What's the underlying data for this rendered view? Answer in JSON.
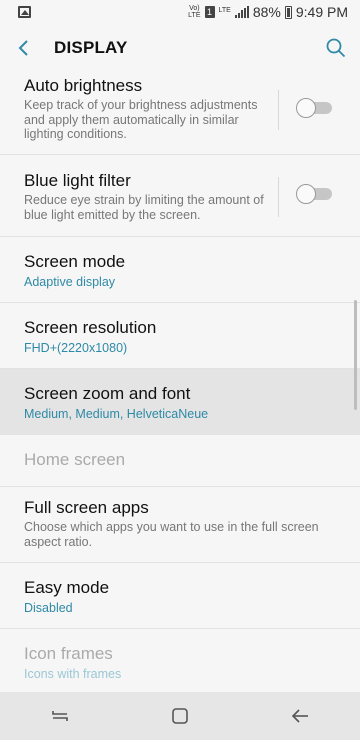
{
  "status_bar": {
    "image_icon": "image-icon",
    "volte_top": "Vo)",
    "volte_bottom": "LTE",
    "sim_number": "1",
    "lte_label": "LTE",
    "battery_percent": "88%",
    "time": "9:49 PM"
  },
  "header": {
    "title": "DISPLAY",
    "back_icon": "back-arrow-icon",
    "search_icon": "search-icon"
  },
  "items": [
    {
      "title": "Auto brightness",
      "subtitle": "Keep track of your brightness adjustments and apply them automatically in similar lighting conditions.",
      "toggle": false
    },
    {
      "title": "Blue light filter",
      "subtitle": "Reduce eye strain by limiting the amount of blue light emitted by the screen.",
      "toggle": false
    },
    {
      "title": "Screen mode",
      "value": "Adaptive display"
    },
    {
      "title": "Screen resolution",
      "value": "FHD+(2220x1080)"
    },
    {
      "title": "Screen zoom and font",
      "value": "Medium, Medium, HelveticaNeue"
    },
    {
      "title": "Home screen",
      "disabled": true
    },
    {
      "title": "Full screen apps",
      "subtitle": "Choose which apps you want to use in the full screen aspect ratio."
    },
    {
      "title": "Easy mode",
      "value": "Disabled"
    },
    {
      "title": "Icon frames",
      "value": "Icons with frames",
      "disabled": true
    }
  ],
  "nav_bar": {
    "recents_icon": "recents-icon",
    "home_icon": "home-icon",
    "back_icon": "back-icon"
  },
  "colors": {
    "accent": "#2e8aa6",
    "background": "#f6f6f6",
    "highlight": "#e4e4e4"
  }
}
